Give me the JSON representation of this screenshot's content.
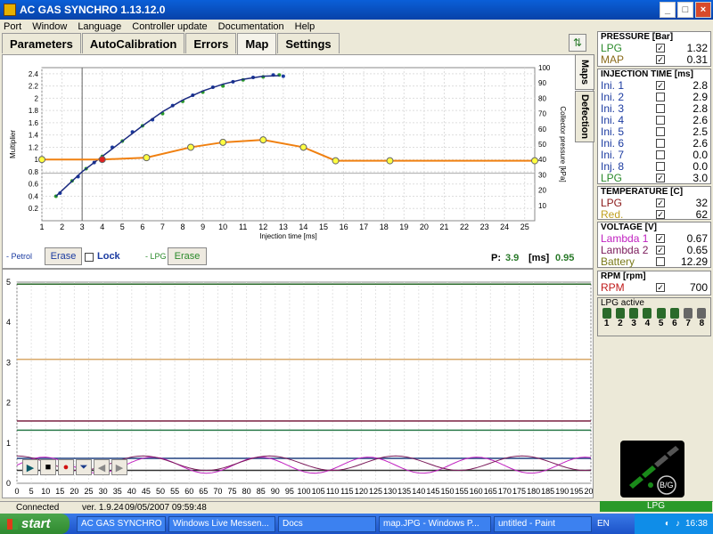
{
  "window": {
    "title": "AC GAS SYNCHRO    1.13.12.0"
  },
  "menu": [
    "Port",
    "Window",
    "Language",
    "Controller update",
    "Documentation",
    "Help"
  ],
  "tabs": [
    "Parameters",
    "AutoCalibration",
    "Errors",
    "Map",
    "Settings"
  ],
  "side_tabs": [
    "Maps",
    "Defection"
  ],
  "map_chart": {
    "ylabel_left": "Multiplier",
    "ylabel_right": "Collector pressure [kPa]",
    "xlabel": "Injection time [ms]",
    "x_ticks": [
      "1",
      "2",
      "3",
      "4",
      "5",
      "6",
      "7",
      "8",
      "9",
      "10",
      "11",
      "12",
      "13",
      "14",
      "15",
      "16",
      "17",
      "18",
      "19",
      "20",
      "21",
      "22",
      "23",
      "24",
      "25"
    ],
    "y_ticks_left": [
      "1",
      "1.2",
      "1.4",
      "1.6",
      "1.8",
      "2",
      "2.2",
      "2.4"
    ],
    "y_ticks_left_low": [
      "0.2",
      "0.4",
      "0.6",
      "0.8"
    ],
    "y_ticks_right": [
      "10",
      "20",
      "30",
      "40",
      "50",
      "60",
      "70",
      "80",
      "90",
      "100"
    ],
    "ylim_left": [
      0,
      2.5
    ],
    "ylim_right": [
      0,
      100
    ],
    "xlim": [
      1,
      25.5
    ],
    "multiplier_points": [
      [
        1.0,
        1.0
      ],
      [
        4.0,
        1.0
      ],
      [
        6.2,
        1.03
      ],
      [
        8.4,
        1.2
      ],
      [
        10.0,
        1.28
      ],
      [
        12.0,
        1.32
      ],
      [
        14.0,
        1.2
      ],
      [
        15.6,
        0.98
      ],
      [
        18.3,
        0.98
      ],
      [
        25.5,
        0.98
      ]
    ],
    "lpg_points": [
      [
        1.7,
        0.4
      ],
      [
        2.5,
        0.65
      ],
      [
        3.2,
        0.85
      ],
      [
        4.0,
        1.05
      ],
      [
        5.0,
        1.3
      ],
      [
        6.0,
        1.55
      ],
      [
        7.0,
        1.75
      ],
      [
        8.0,
        1.95
      ],
      [
        9.0,
        2.1
      ],
      [
        10.0,
        2.2
      ],
      [
        11.0,
        2.3
      ],
      [
        12.0,
        2.35
      ],
      [
        12.8,
        2.38
      ]
    ],
    "petrol_points": [
      [
        1.9,
        0.45
      ],
      [
        2.8,
        0.72
      ],
      [
        3.6,
        0.95
      ],
      [
        4.5,
        1.2
      ],
      [
        5.5,
        1.45
      ],
      [
        6.5,
        1.65
      ],
      [
        7.5,
        1.88
      ],
      [
        8.5,
        2.05
      ],
      [
        9.5,
        2.18
      ],
      [
        10.5,
        2.27
      ],
      [
        11.5,
        2.34
      ],
      [
        12.5,
        2.38
      ],
      [
        13.0,
        2.36
      ]
    ],
    "fit_curve": [
      [
        1.7,
        0.4
      ],
      [
        3,
        0.8
      ],
      [
        4,
        1.05
      ],
      [
        5,
        1.3
      ],
      [
        6,
        1.55
      ],
      [
        7,
        1.78
      ],
      [
        8,
        1.97
      ],
      [
        9,
        2.12
      ],
      [
        10,
        2.23
      ],
      [
        11,
        2.31
      ],
      [
        12,
        2.36
      ],
      [
        12.8,
        2.37
      ]
    ],
    "marker_x": 3.0,
    "baseline_y": 0.98
  },
  "map_controls": {
    "petrol_label": "- Petrol",
    "erase1": "Erase",
    "lock": "Lock",
    "lpg_label": "- LPG",
    "erase2": "Erase",
    "p_label": "P:",
    "p_value": "3.9",
    "ms_label": "[ms]",
    "p_value2": "0.95"
  },
  "bottom_chart": {
    "y_ticks": [
      "0",
      "1",
      "2",
      "3",
      "4",
      "5"
    ],
    "x_ticks": [
      "0",
      "5",
      "10",
      "15",
      "20",
      "25",
      "30",
      "35",
      "40",
      "45",
      "50",
      "55",
      "60",
      "65",
      "70",
      "75",
      "80",
      "85",
      "90",
      "95",
      "100",
      "105",
      "110",
      "115",
      "120",
      "125",
      "130",
      "135",
      "140",
      "145",
      "150",
      "155",
      "160",
      "165",
      "170",
      "175",
      "180",
      "185",
      "190",
      "195",
      "200"
    ],
    "ylim": [
      0,
      5
    ],
    "xlim": [
      0,
      200
    ],
    "hlines": [
      {
        "y": 4.95,
        "color": "#2a6a2a"
      },
      {
        "y": 3.08,
        "color": "#d8a86a"
      },
      {
        "y": 1.55,
        "color": "#7a2040"
      },
      {
        "y": 1.32,
        "color": "#2a7a4a"
      },
      {
        "y": 0.62,
        "color": "#204080"
      },
      {
        "y": 0.32,
        "color": "#303030"
      }
    ],
    "player_controls": [
      "play",
      "stop",
      "record",
      "stop-record",
      "back",
      "forward"
    ]
  },
  "pressure": {
    "title": "PRESSURE [Bar]",
    "rows": [
      {
        "label": "LPG",
        "checked": true,
        "value": "1.32",
        "color": "#2a8a2a"
      },
      {
        "label": "MAP",
        "checked": true,
        "value": "0.31",
        "color": "#8a6a1a"
      }
    ]
  },
  "injection": {
    "title": "INJECTION TIME [ms]",
    "rows": [
      {
        "label": "Ini. 1",
        "checked": true,
        "value": "2.8",
        "color": "#1a3aa0"
      },
      {
        "label": "Ini. 2",
        "checked": false,
        "value": "2.9",
        "color": "#1a3aa0"
      },
      {
        "label": "Ini. 3",
        "checked": false,
        "value": "2.8",
        "color": "#1a3aa0"
      },
      {
        "label": "Ini. 4",
        "checked": false,
        "value": "2.6",
        "color": "#1a3aa0"
      },
      {
        "label": "Ini. 5",
        "checked": false,
        "value": "2.5",
        "color": "#1a3aa0"
      },
      {
        "label": "Ini. 6",
        "checked": false,
        "value": "2.6",
        "color": "#1a3aa0"
      },
      {
        "label": "Ini. 7",
        "checked": false,
        "value": "0.0",
        "color": "#1a3aa0"
      },
      {
        "label": "Inj. 8",
        "checked": false,
        "value": "0.0",
        "color": "#1a3aa0"
      },
      {
        "label": "LPG",
        "checked": true,
        "value": "3.0",
        "color": "#2a8a2a"
      }
    ]
  },
  "temperature": {
    "title": "TEMPERATURE [C]",
    "rows": [
      {
        "label": "LPG",
        "checked": true,
        "value": "32",
        "color": "#8a1a1a"
      },
      {
        "label": "Red.",
        "checked": true,
        "value": "62",
        "color": "#c0a020"
      }
    ]
  },
  "voltage": {
    "title": "VOLTAGE [V]",
    "rows": [
      {
        "label": "Lambda 1",
        "checked": true,
        "value": "0.67",
        "color": "#c020c0"
      },
      {
        "label": "Lambda 2",
        "checked": true,
        "value": "0.65",
        "color": "#7a1a5a"
      },
      {
        "label": "Battery",
        "checked": false,
        "value": "12.29",
        "color": "#7a7a1a"
      }
    ]
  },
  "rpm": {
    "title": "RPM [rpm]",
    "rows": [
      {
        "label": "RPM",
        "checked": true,
        "value": "700",
        "color": "#c01a1a"
      }
    ]
  },
  "lpg_active": {
    "title": "LPG active",
    "numbers": [
      "1",
      "2",
      "3",
      "4",
      "5",
      "6",
      "7",
      "8"
    ]
  },
  "gauge": {
    "label": "B/G"
  },
  "status": {
    "connected": "Connected",
    "version": "ver. 1.9.24",
    "datetime": "09/05/2007  09:59:48",
    "lpg": "LPG"
  },
  "taskbar": {
    "start": "start",
    "items": [
      "AC GAS SYNCHRO",
      "Windows Live Messen...",
      "Docs",
      "map.JPG - Windows P...",
      "untitled - Paint"
    ],
    "lang": "EN",
    "clock": "16:38"
  }
}
